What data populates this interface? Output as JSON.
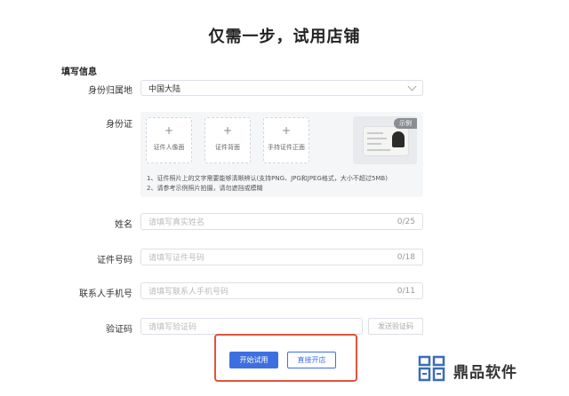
{
  "page": {
    "title": "仅需一步，试用店铺"
  },
  "form": {
    "section_title": "填写信息",
    "region": {
      "label": "身份归属地",
      "value": "中国大陆"
    },
    "id_card": {
      "label": "身份证",
      "uploads": [
        "证件人像面",
        "证件背面",
        "手持证件正面"
      ],
      "sample_tag": "示例",
      "notes": [
        "1、证件照片上的文字需要能够清晰辨认(支持PNG、JPG和JPEG格式，大小不超过5MB)",
        "2、请参考示例照片拍摄，请勿遮挡或模糊"
      ]
    },
    "name": {
      "label": "姓名",
      "placeholder": "请填写真实姓名",
      "count": "0/25"
    },
    "id_number": {
      "label": "证件号码",
      "placeholder": "请填写证件号码",
      "count": "0/18"
    },
    "phone": {
      "label": "联系人手机号",
      "placeholder": "请填写联系人手机号码",
      "count": "0/11"
    },
    "code": {
      "label": "验证码",
      "placeholder": "请填写验证码",
      "send_button": "发送验证码"
    }
  },
  "actions": {
    "trial_button": "开始试用",
    "direct_button": "直接开店"
  },
  "watermark": {
    "text": "鼎品软件"
  },
  "colors": {
    "primary": "#3e6fe1",
    "highlight": "#e0543a"
  },
  "icons": {
    "plus": "plus-icon",
    "chevron": "chevron-down-icon",
    "logo": "brand-logo-icon"
  }
}
